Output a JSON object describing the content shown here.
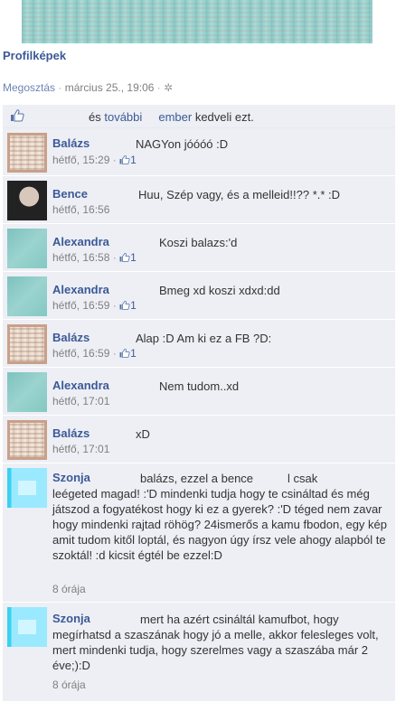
{
  "album": {
    "title": "Profilképek"
  },
  "meta": {
    "share": "Megosztás",
    "sep": " · ",
    "date": "március 25., 19:06",
    "sep2": " · "
  },
  "likebar": {
    "pre": "és",
    "others": "további",
    "people": "ember",
    "post": "kedveli ezt."
  },
  "comments": [
    {
      "author": "Balázs",
      "avatar": "balazs",
      "text": "NAGYon jóóóó :D",
      "time": "hétfő, 15:29",
      "likes": "1"
    },
    {
      "author": "Bence",
      "avatar": "bence",
      "text": "Huu, Szép vagy, és a melleid!!?? *.* :D",
      "time": "hétfő, 16:56",
      "likes": ""
    },
    {
      "author": "Alexandra",
      "avatar": "alex",
      "text": "Koszi balazs:'d",
      "time": "hétfő, 16:58",
      "likes": "1"
    },
    {
      "author": "Alexandra",
      "avatar": "alex",
      "text": "Bmeg xd koszi xdxd:dd",
      "time": "hétfő, 16:59",
      "likes": "1"
    },
    {
      "author": "Balázs",
      "avatar": "balazs",
      "text": "Alap :D Am ki ez a FB ?D:",
      "time": "hétfő, 16:59",
      "likes": "1"
    },
    {
      "author": "Alexandra",
      "avatar": "alex",
      "text": "Nem tudom..xd",
      "time": "hétfő, 17:01",
      "likes": ""
    },
    {
      "author": "Balázs",
      "avatar": "balazs",
      "text": "xD",
      "time": "hétfő, 17:01",
      "likes": ""
    },
    {
      "author": "Szonja",
      "avatar": "szonja",
      "text_line1": "balázs, ezzel a bence",
      "text_line1b": "l csak",
      "text_rest": "leégeted magad! :'D mindenki tudja hogy te csináltad és még játszod a fogyatékost hogy ki ez a gyerek? :'D téged nem zavar hogy mindenki rajtad röhög? 24ismerős a kamu fbodon, egy kép amit tudom kitől loptál, és nagyon úgy írsz vele ahogy alapból te szoktál! :d kicsit égtél be ezzel:D",
      "time": "8 órája"
    },
    {
      "author": "Szonja",
      "avatar": "szonja",
      "text_line1": "mert ha azért csináltál kamufbot, hogy",
      "text_rest": "megírhatsd a szaszának hogy jó a melle, akkor felesleges volt, mert mindenki tudja, hogy szerelmes vagy a szaszába már 2 éve;):D",
      "time": "8 órája"
    }
  ]
}
